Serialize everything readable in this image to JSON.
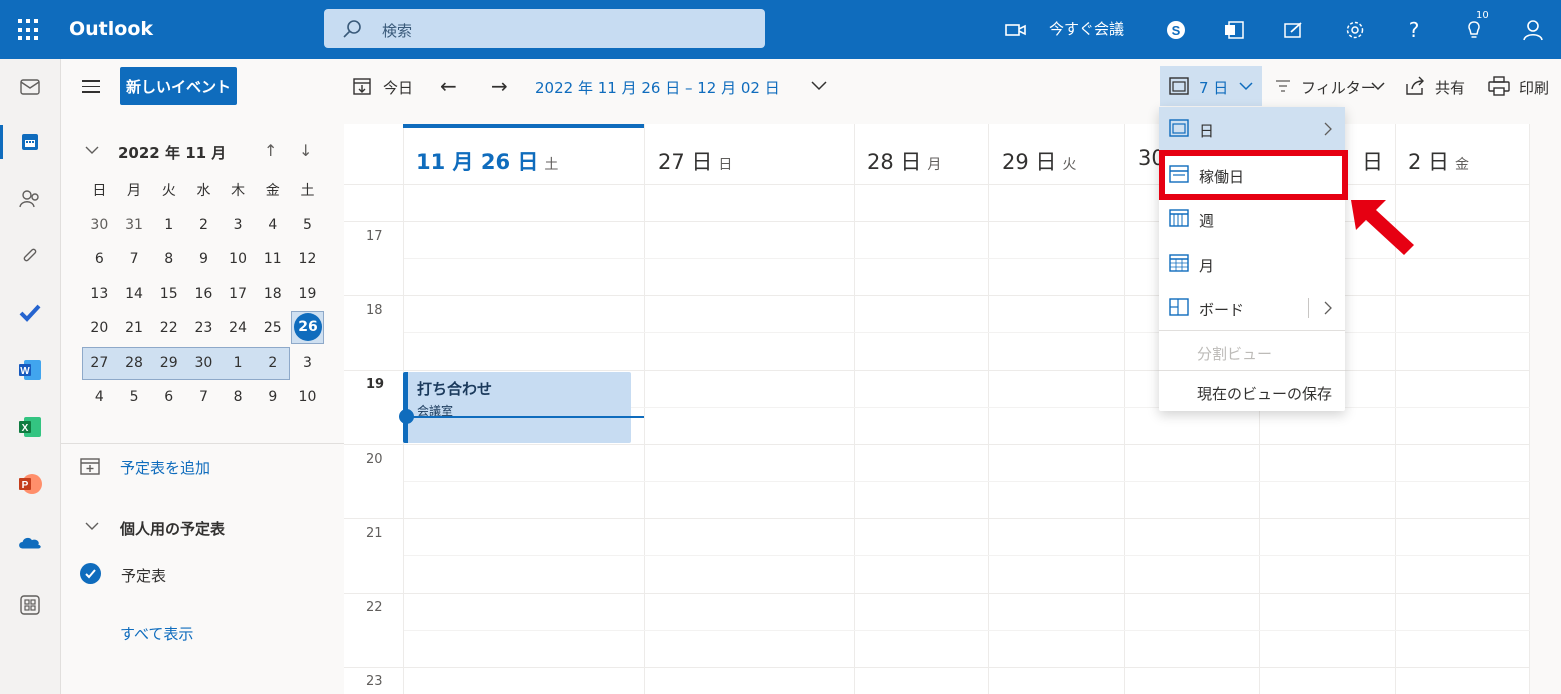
{
  "app": {
    "name": "Outlook"
  },
  "search": {
    "placeholder": "検索"
  },
  "topbar": {
    "meet_now": "今すぐ会議",
    "notifications_count": "10",
    "help": "?"
  },
  "rail": {
    "icons": [
      "mail-icon",
      "calendar-icon",
      "people-icon",
      "attach-icon",
      "todo-icon",
      "word-icon",
      "excel-icon",
      "powerpoint-icon",
      "onedrive-icon",
      "apps-icon"
    ]
  },
  "leftpane": {
    "new_event": "新しいイベント",
    "mini_month": "2022 年 11 月",
    "weekdays": [
      "日",
      "月",
      "火",
      "水",
      "木",
      "金",
      "土"
    ],
    "weeks": [
      [
        "30",
        "31",
        "1",
        "2",
        "3",
        "4",
        "5"
      ],
      [
        "6",
        "7",
        "8",
        "9",
        "10",
        "11",
        "12"
      ],
      [
        "13",
        "14",
        "15",
        "16",
        "17",
        "18",
        "19"
      ],
      [
        "20",
        "21",
        "22",
        "23",
        "24",
        "25",
        "26"
      ],
      [
        "27",
        "28",
        "29",
        "30",
        "1",
        "2",
        "3"
      ],
      [
        "4",
        "5",
        "6",
        "7",
        "8",
        "9",
        "10"
      ]
    ],
    "today": "26",
    "add_calendar": "予定表を追加",
    "personal_group": "個人用の予定表",
    "calendar_name": "予定表",
    "show_all": "すべて表示"
  },
  "command": {
    "today": "今日",
    "range": "2022 年 11 月 26 日 – 12 月 02 日",
    "view": "7 日",
    "filter": "フィルター",
    "share": "共有",
    "print": "印刷"
  },
  "days": [
    {
      "num": "11 月 26 日",
      "wd": "土"
    },
    {
      "num": "27 日",
      "wd": "日"
    },
    {
      "num": "28 日",
      "wd": "月"
    },
    {
      "num": "29 日",
      "wd": "火"
    },
    {
      "num": "30",
      "wd": ""
    },
    {
      "num": "日",
      "wd": ""
    },
    {
      "num": "2 日",
      "wd": "金"
    }
  ],
  "hours": [
    "17",
    "18",
    "19",
    "20",
    "21",
    "22",
    "23"
  ],
  "event": {
    "title": "打ち合わせ",
    "location": "会議室"
  },
  "view_menu": {
    "items": [
      {
        "label": "日"
      },
      {
        "label": "稼働日"
      },
      {
        "label": "週"
      },
      {
        "label": "月"
      },
      {
        "label": "ボード"
      },
      {
        "label": "分割ビュー"
      },
      {
        "label": "現在のビューの保存"
      }
    ]
  },
  "colors": {
    "brand": "#0f6cbd",
    "highlight": "#e60012"
  }
}
